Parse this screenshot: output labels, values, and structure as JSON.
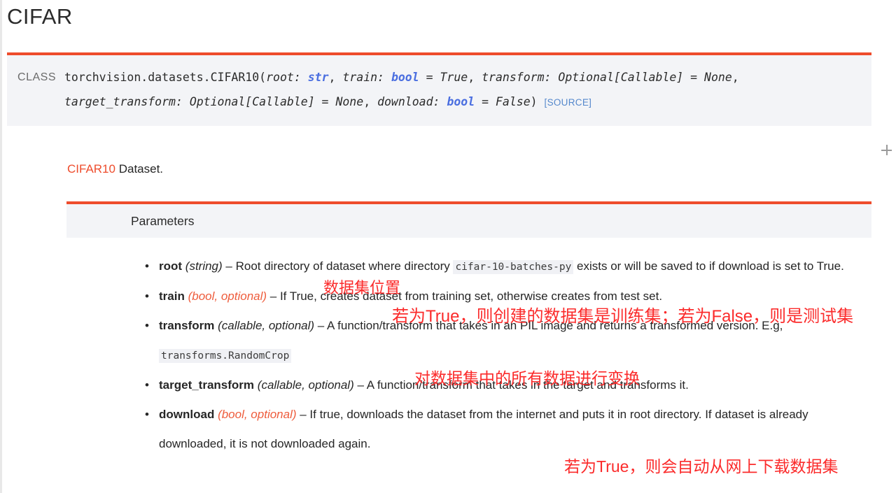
{
  "page": {
    "title": "CIFAR",
    "accent_color": "#ee4c2c",
    "block_bg": "#f3f4f7",
    "annotation_color": "#fb2b2b",
    "type_color": "#4a6ee0",
    "link_color": "#5588cc"
  },
  "signature": {
    "label": "CLASS",
    "qualname": "torchvision.datasets.CIFAR10(",
    "tokens": [
      {
        "text": "root: ",
        "style": "param"
      },
      {
        "text": "str",
        "style": "type"
      },
      {
        "text": ", ",
        "style": "plain"
      },
      {
        "text": "train: ",
        "style": "param"
      },
      {
        "text": "bool",
        "style": "type"
      },
      {
        "text": " = ",
        "style": "plain"
      },
      {
        "text": "True",
        "style": "val"
      },
      {
        "text": ", ",
        "style": "plain"
      },
      {
        "text": "transform: ",
        "style": "param"
      },
      {
        "text": "Optional[Callable]",
        "style": "val"
      },
      {
        "text": " = ",
        "style": "plain"
      },
      {
        "text": "None",
        "style": "val"
      },
      {
        "text": ", ",
        "style": "plain"
      },
      {
        "text": "target_transform: ",
        "style": "param"
      },
      {
        "text": "Optional[Callable]",
        "style": "val"
      },
      {
        "text": " = ",
        "style": "plain"
      },
      {
        "text": "None",
        "style": "val"
      },
      {
        "text": ", ",
        "style": "plain"
      },
      {
        "text": "download: ",
        "style": "param"
      },
      {
        "text": "bool",
        "style": "type"
      },
      {
        "text": " = ",
        "style": "plain"
      },
      {
        "text": "False",
        "style": "val"
      },
      {
        "text": ")",
        "style": "plain"
      }
    ],
    "line1": "torchvision.datasets.CIFAR10(",
    "source_link": "[SOURCE]"
  },
  "caption": {
    "link_text": "CIFAR10",
    "rest_text": " Dataset."
  },
  "parameters_header": "Parameters",
  "parameters": [
    {
      "name": "root",
      "type_text": "(string)",
      "type_is_red": false,
      "desc_before_code": " – Root directory of dataset where directory ",
      "code": "cifar-10-batches-py",
      "desc_after_code": " exists or will be saved to if download is set to True."
    },
    {
      "name": "train",
      "type_text": "(bool, optional)",
      "type_is_red": true,
      "desc_before_code": " – If True, creates dataset from training set, otherwise creates from test set.",
      "code": "",
      "desc_after_code": ""
    },
    {
      "name": "transform",
      "type_text": "(callable, optional)",
      "type_is_red": false,
      "desc_before_code": " – A function/transform that takes in an PIL image and returns a transformed version. E.g, ",
      "code": "transforms.RandomCrop",
      "desc_after_code": ""
    },
    {
      "name": "target_transform",
      "type_text": "(callable, optional)",
      "type_is_red": false,
      "desc_before_code": " – A function/transform that takes in the target and transforms it.",
      "code": "",
      "desc_after_code": ""
    },
    {
      "name": "download",
      "type_text": "(bool, optional)",
      "type_is_red": true,
      "desc_before_code": " – If true, downloads the dataset from the internet and puts it in root directory. If dataset is already downloaded, it is not downloaded again.",
      "code": "",
      "desc_after_code": ""
    }
  ],
  "annotations": {
    "root": "数据集位置",
    "train": "若为True，则创建的数据集是训练集；若为False，则是测试集",
    "transform": "对数据集中的所有数据进行变换",
    "download": "若为True，则会自动从网上下载数据集"
  },
  "cursor": {
    "icon": "plus-crosshair-cursor"
  }
}
